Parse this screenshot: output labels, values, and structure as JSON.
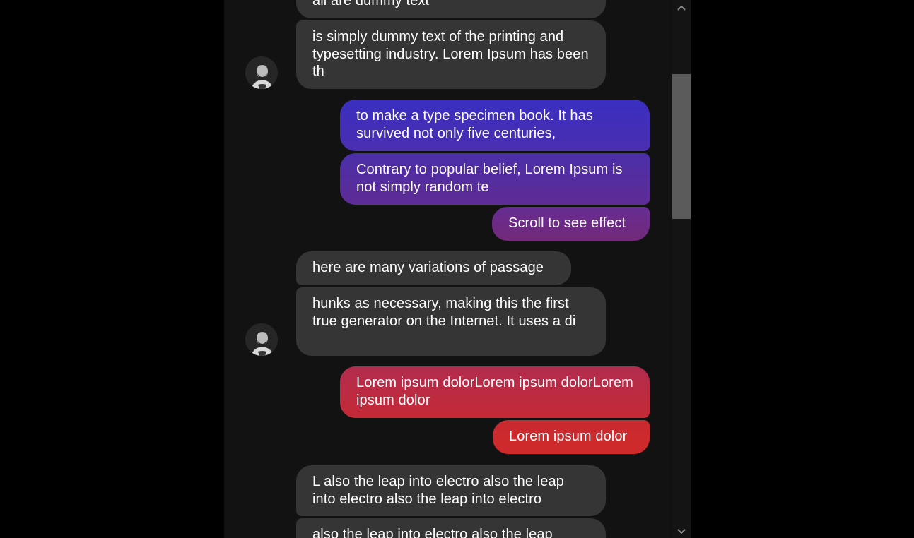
{
  "messages": [
    {
      "id": "m0",
      "side": "received",
      "text": "all are dummy text"
    },
    {
      "id": "m1",
      "side": "received",
      "text": "is simply dummy text of the printing and typesetting industry. Lorem Ipsum has been th"
    },
    {
      "id": "m2",
      "side": "sent",
      "text": "to make a type specimen book. It has survived not only five centuries,"
    },
    {
      "id": "m3",
      "side": "sent",
      "text": "Contrary to popular belief, Lorem Ipsum is not simply random te"
    },
    {
      "id": "m4",
      "side": "sent",
      "text": "Scroll to see effect"
    },
    {
      "id": "m5",
      "side": "received",
      "text": "here are many variations of passage"
    },
    {
      "id": "m6",
      "side": "received",
      "text": "hunks as necessary, making this the first true generator on the Internet. It uses a di"
    },
    {
      "id": "m7",
      "side": "sent",
      "text": "Lorem ipsum dolorLorem ipsum dolorLorem ipsum dolor"
    },
    {
      "id": "m8",
      "side": "sent",
      "text": "Lorem ipsum dolor"
    },
    {
      "id": "m9",
      "side": "received",
      "text": "L also the leap into electro also the leap into electro also the leap into electro"
    },
    {
      "id": "m10",
      "side": "received",
      "text": "also the leap into electro also the leap"
    }
  ],
  "colors": {
    "page_background": "#000000",
    "panel_background": "#121212",
    "received_bubble": "#353535",
    "sent_gradient_top": "#3a2fc0",
    "sent_gradient_mid": "#6b2c8e",
    "sent_gradient_bottom": "#d02a2a"
  },
  "icons": {
    "avatar": "user-avatar-photo",
    "scroll_up": "chevron-up-icon",
    "scroll_down": "chevron-down-icon"
  }
}
